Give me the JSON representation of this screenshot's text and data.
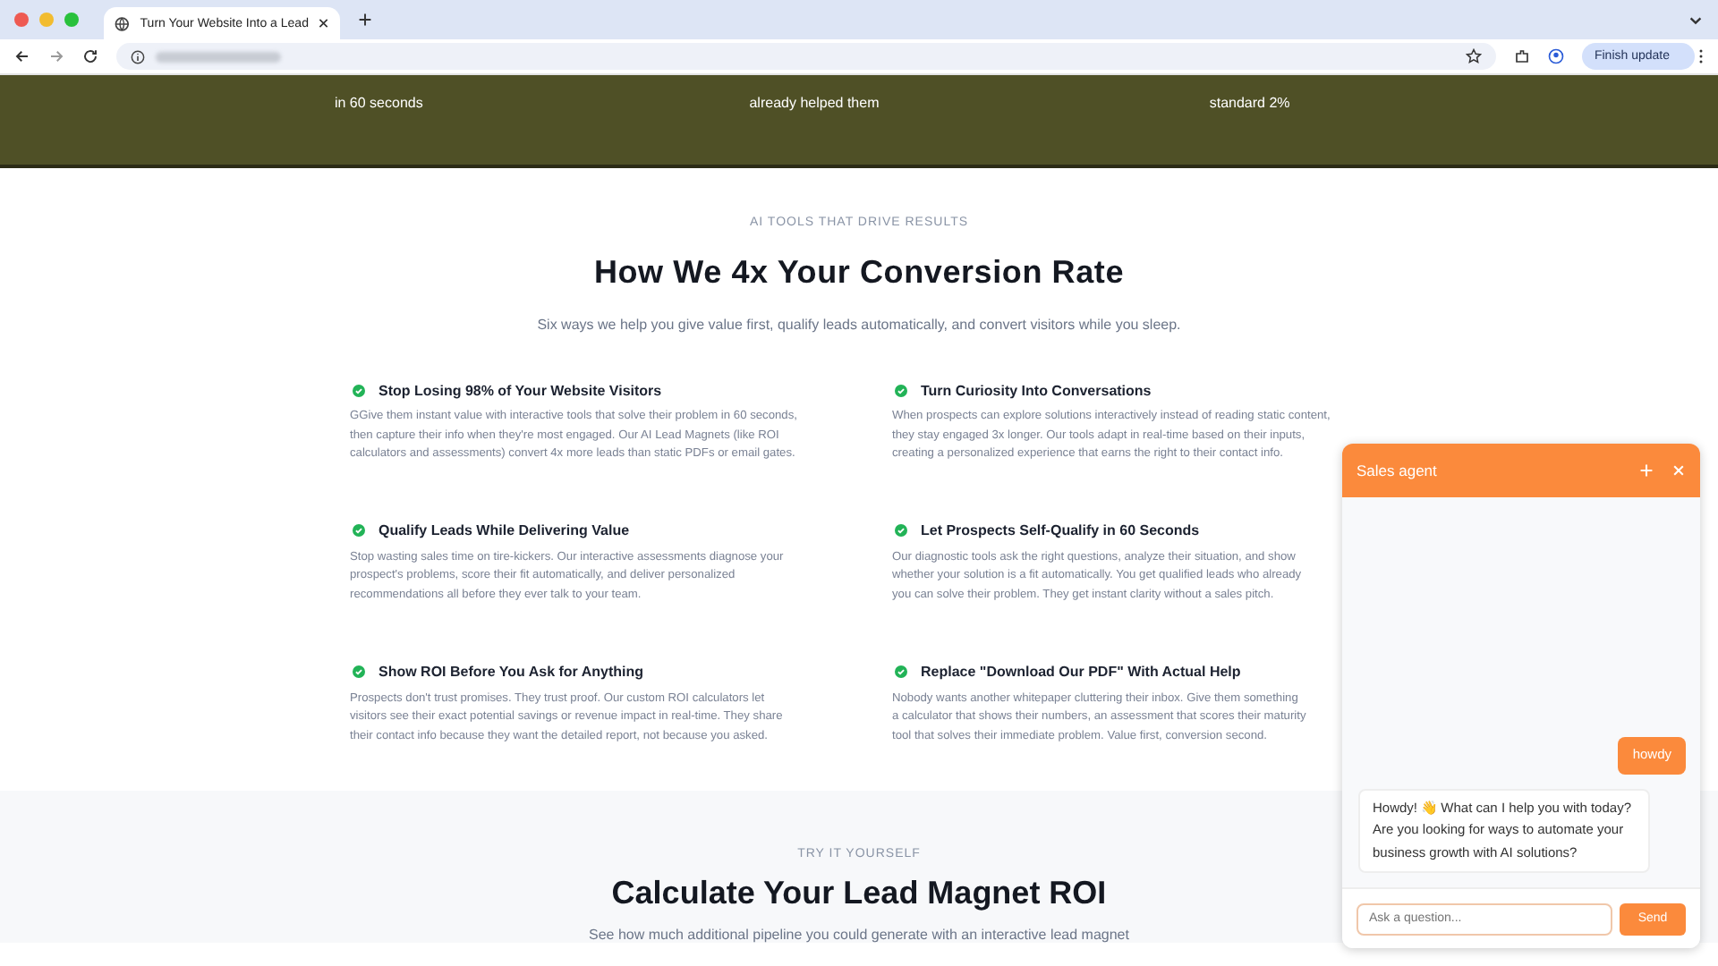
{
  "browser": {
    "tab_title": "Turn Your Website Into a Lead",
    "update_button": "Finish update"
  },
  "stats_band": {
    "items": [
      "in 60 seconds",
      "already helped them",
      "standard 2%"
    ]
  },
  "features_section": {
    "eyebrow": "AI TOOLS THAT DRIVE RESULTS",
    "title": "How We 4x Your Conversion Rate",
    "subtitle": "Six ways we help you give value first, qualify leads automatically, and convert visitors while you sleep.",
    "features": [
      {
        "title": "Stop Losing 98% of Your Website Visitors",
        "lines": [
          "GGive them instant value with interactive tools that solve their problem in 60 seconds,",
          "then capture their info when they're most engaged. Our AI Lead Magnets (like ROI",
          "calculators and assessments) convert 4x more leads than static PDFs or email gates."
        ]
      },
      {
        "title": "Turn Curiosity Into Conversations",
        "lines": [
          "When prospects can explore solutions interactively instead of reading static content,",
          "they stay engaged 3x longer. Our tools adapt in real-time based on their inputs,",
          "creating a personalized experience that earns the right to their contact info."
        ]
      },
      {
        "title": "Qualify Leads While Delivering Value",
        "lines": [
          "Stop wasting sales time on tire-kickers. Our interactive assessments diagnose your",
          "prospect's problems, score their fit automatically, and deliver personalized",
          "recommendations all before they ever talk to your team."
        ]
      },
      {
        "title": "Let Prospects Self-Qualify in 60 Seconds",
        "lines": [
          "Our diagnostic tools ask the right questions, analyze their situation, and show",
          "whether your solution is a fit automatically. You get qualified leads who already",
          "you can solve their problem. They get instant clarity without a sales pitch."
        ]
      },
      {
        "title": "Show ROI Before You Ask for Anything",
        "lines": [
          "Prospects don't trust promises. They trust proof. Our custom ROI calculators let",
          "visitors see their exact potential savings or revenue impact in real-time. They share",
          "their contact info because they want the detailed report, not because you asked."
        ]
      },
      {
        "title": "Replace \"Download Our PDF\" With Actual Help",
        "lines": [
          "Nobody wants another whitepaper cluttering their inbox. Give them something",
          "a calculator that shows their numbers, an assessment that scores their maturity",
          "tool that solves their immediate problem. Value first, conversion second."
        ]
      }
    ]
  },
  "roi_section": {
    "eyebrow": "TRY IT YOURSELF",
    "title": "Calculate Your Lead Magnet ROI",
    "subtitle": "See how much additional pipeline you could generate with an interactive lead magnet"
  },
  "chat": {
    "title": "Sales agent",
    "messages": [
      {
        "kind": "user",
        "text": "howdy"
      },
      {
        "kind": "agent",
        "text": "Howdy! 👋 What can I help you with today? Are you looking for ways to automate your business growth with AI solutions?"
      }
    ],
    "input_placeholder": "Ask a question...",
    "send_button": "Send"
  }
}
